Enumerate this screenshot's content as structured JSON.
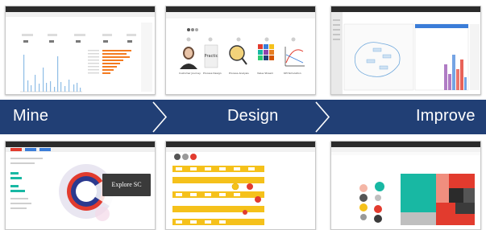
{
  "stages": [
    {
      "label": "Mine"
    },
    {
      "label": "Design"
    },
    {
      "label": "Improve"
    }
  ],
  "thumbnails": {
    "design": {
      "cards": [
        {
          "caption": "Customer Journey"
        },
        {
          "caption": "Process Design"
        },
        {
          "caption": "Process Analysis"
        },
        {
          "caption": "Value Stream"
        },
        {
          "caption": "KPI Simulation"
        }
      ]
    },
    "mine_explore": {
      "tooltip": "Explore SC System"
    }
  },
  "colors": {
    "banner": "#213f75",
    "chevron_line": "#ffffff",
    "spike_blue": "#8fbde6",
    "orange_bar": "#f47b20",
    "yellow_flow": "#f5c11b",
    "teal": "#18b8a3",
    "red": "#e23b2e"
  }
}
